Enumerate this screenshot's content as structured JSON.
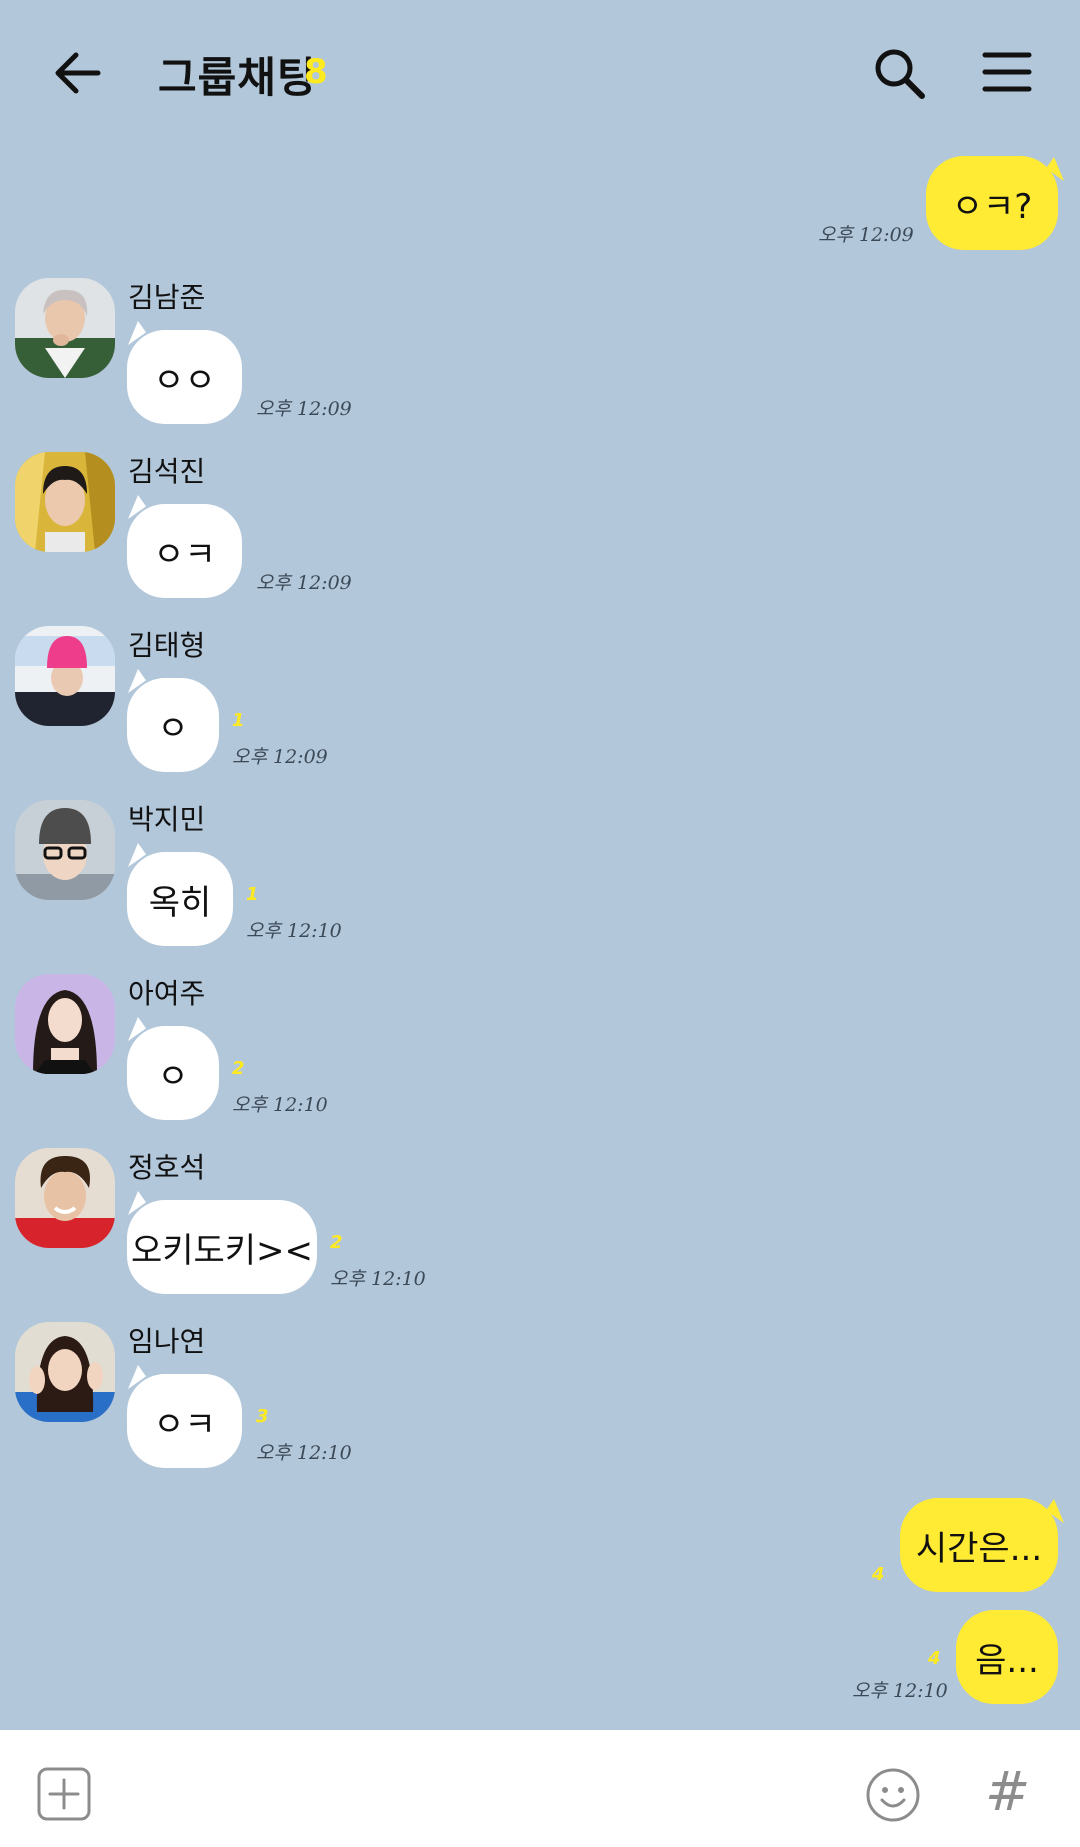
{
  "header": {
    "title": "그룹채팅",
    "member_count": "8"
  },
  "messages": [
    {
      "sender": "",
      "mine": true,
      "text": "ㅇㅋ?",
      "time": "오후 12:09",
      "unread": ""
    },
    {
      "sender": "김남준",
      "mine": false,
      "text": "ㅇㅇ",
      "time": "오후 12:09",
      "unread": ""
    },
    {
      "sender": "김석진",
      "mine": false,
      "text": "ㅇㅋ",
      "time": "오후 12:09",
      "unread": ""
    },
    {
      "sender": "김태형",
      "mine": false,
      "text": "ㅇ",
      "time": "오후 12:09",
      "unread": "1"
    },
    {
      "sender": "박지민",
      "mine": false,
      "text": "옥히",
      "time": "오후 12:10",
      "unread": "1"
    },
    {
      "sender": "아여주",
      "mine": false,
      "text": "ㅇ",
      "time": "오후 12:10",
      "unread": "2"
    },
    {
      "sender": "정호석",
      "mine": false,
      "text": "오키도키><",
      "time": "오후 12:10",
      "unread": "2"
    },
    {
      "sender": "임나연",
      "mine": false,
      "text": "ㅇㅋ",
      "time": "오후 12:10",
      "unread": "3"
    },
    {
      "sender": "",
      "mine": true,
      "text": "시간은...",
      "time": "",
      "unread": "4"
    },
    {
      "sender": "",
      "mine": true,
      "text": "음...",
      "time": "오후 12:10",
      "unread": "4"
    }
  ],
  "avatars": {
    "kim_namjoon": "avatar-namjoon",
    "kim_seokjin": "avatar-seokjin",
    "kim_taehyung": "avatar-taehyung",
    "park_jimin": "avatar-jimin",
    "a_yeoju": "avatar-yeoju",
    "jung_hoseok": "avatar-hoseok",
    "im_nayeon": "avatar-nayeon"
  },
  "icons": {
    "back": "arrow-left-icon",
    "search": "search-icon",
    "menu": "hamburger-menu-icon",
    "plus": "plus-box-icon",
    "emoji": "smiley-icon",
    "hash": "hash-icon"
  },
  "input_bar": {
    "hash_label": "#"
  },
  "colors": {
    "background": "#b2c7da",
    "my_bubble": "#ffeb33",
    "other_bubble": "#ffffff",
    "unread": "#ffe91f"
  }
}
